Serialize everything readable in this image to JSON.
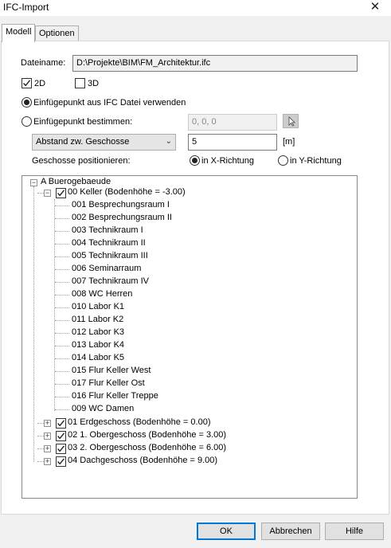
{
  "window": {
    "title": "IFC-Import",
    "close_glyph": "✕"
  },
  "tabs": [
    {
      "label": "Modell",
      "active": true
    },
    {
      "label": "Optionen",
      "active": false
    }
  ],
  "file": {
    "label": "Dateiname:",
    "value": "D:\\Projekte\\BIM\\FM_Architektur.ifc"
  },
  "options": {
    "chk_2d": {
      "label": "2D",
      "checked": true
    },
    "chk_3d": {
      "label": "3D",
      "checked": false
    },
    "radio_ifc": {
      "label": "Einfügepunkt aus IFC Datei verwenden",
      "selected": true
    },
    "radio_custom": {
      "label": "Einfügepunkt bestimmen:",
      "selected": false
    },
    "point_value": "0, 0, 0",
    "distance_combo": "Abstand zw. Geschosse",
    "distance_value": "5",
    "distance_unit": "[m]",
    "position_label": "Geschosse positionieren:",
    "radio_x": {
      "label": "in X-Richtung",
      "selected": true
    },
    "radio_y": {
      "label": "in Y-Richtung",
      "selected": false
    }
  },
  "tree": {
    "root": {
      "label": "A Buerogebaeude",
      "expander": "−"
    },
    "keller": {
      "label": "00 Keller (Bodenhöhe = -3.00)",
      "expander": "−",
      "checked": true,
      "children": [
        "001 Besprechungsraum I",
        "002 Besprechungsraum II",
        "003 Technikraum I",
        "004 Technikraum II",
        "005 Technikraum III",
        "006 Seminarraum",
        "007 Technikraum IV",
        "008 WC Herren",
        "010 Labor K1",
        "011 Labor K2",
        "012 Labor K3",
        "013 Labor K4",
        "014 Labor K5",
        "015 Flur Keller West",
        "017 Flur Keller Ost",
        "016 Flur Keller Treppe",
        "009 WC Damen"
      ]
    },
    "floors": [
      {
        "label": "01 Erdgeschoss (Bodenhöhe = 0.00)",
        "expander": "+",
        "checked": true
      },
      {
        "label": "02 1. Obergeschoss (Bodenhöhe = 3.00)",
        "expander": "+",
        "checked": true
      },
      {
        "label": "03 2. Obergeschoss (Bodenhöhe = 6.00)",
        "expander": "+",
        "checked": true
      },
      {
        "label": "04 Dachgeschoss (Bodenhöhe = 9.00)",
        "expander": "+",
        "checked": true
      }
    ]
  },
  "buttons": {
    "ok": "OK",
    "cancel": "Abbrechen",
    "help": "Hilfe"
  },
  "colors": {
    "default_button_border": "#0078d7",
    "window_bg": "#f0f0f0"
  }
}
